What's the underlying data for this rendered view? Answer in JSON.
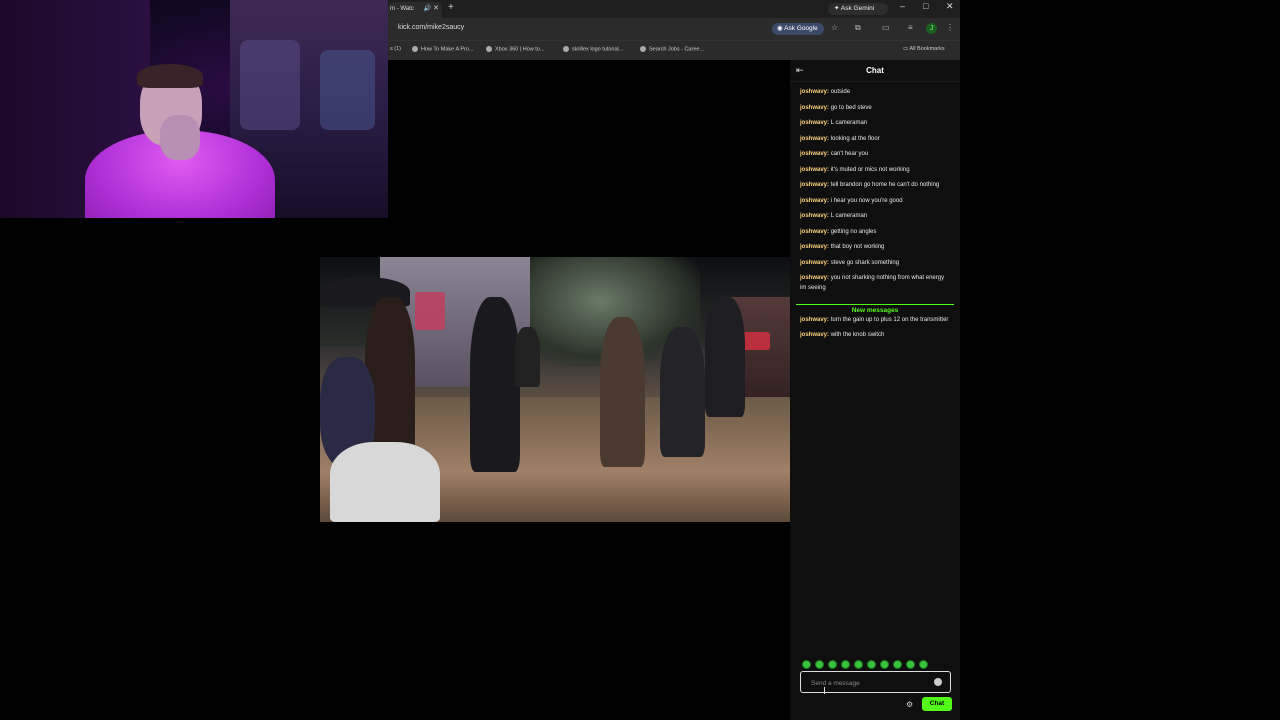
{
  "browser": {
    "tab_title": "m - Watc",
    "new_tab_icon": "plus",
    "ask_gemini": "Ask Gemini",
    "url": "kick.com/mike2saucy",
    "ask_google": "Ask Google",
    "avatar_letter": "J",
    "bookmarks": [
      "s (1)",
      "How To Make A Pro...",
      "Xbox 360 | How to...",
      "skrillex logo tutorial...",
      "Search Jobs - Caree..."
    ],
    "all_bookmarks": "All Bookmarks"
  },
  "chat": {
    "title": "Chat",
    "messages": [
      {
        "user": "joshwavy:",
        "text": "outside"
      },
      {
        "user": "joshwavy:",
        "text": "go to bed steve"
      },
      {
        "user": "joshwavy:",
        "text": "L cameraman"
      },
      {
        "user": "joshwavy:",
        "text": "looking at the floor"
      },
      {
        "user": "joshwavy:",
        "text": "can't hear you"
      },
      {
        "user": "joshwavy:",
        "text": "it's muted or mics not working"
      },
      {
        "user": "joshwavy:",
        "text": "tell brandon go home he can't do nothing"
      },
      {
        "user": "joshwavy:",
        "text": "i hear you now you're good"
      },
      {
        "user": "joshwavy:",
        "text": "L cameraman"
      },
      {
        "user": "joshwavy:",
        "text": "getting no angles"
      },
      {
        "user": "joshwavy:",
        "text": "that boy not working"
      },
      {
        "user": "joshwavy:",
        "text": "steve go shark something"
      },
      {
        "user": "joshwavy:",
        "text": "you not sharking nothing from what energy im seeing"
      }
    ],
    "new_messages_label": "New messages",
    "new_messages": [
      {
        "user": "joshwavy:",
        "text": "turn the gain up to plus 12 on the transmitter"
      },
      {
        "user": "joshwavy:",
        "text": "with the knob switch"
      }
    ],
    "input_placeholder": "Send a message",
    "send_label": "Chat"
  },
  "colors": {
    "accent": "#53fc18",
    "username": "#ffd27a",
    "chat_bg": "#0f0f10"
  }
}
